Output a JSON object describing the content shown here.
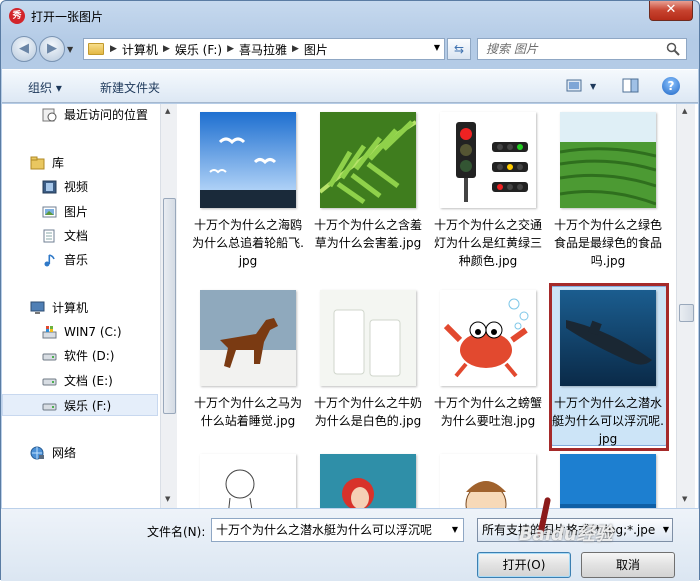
{
  "window": {
    "title": "打开一张图片",
    "app_icon_text": "秀",
    "close_glyph": "✕"
  },
  "nav": {
    "back_glyph": "◀",
    "forward_glyph": "▶",
    "breadcrumbs": [
      "计算机",
      "娱乐 (F:)",
      "喜马拉雅",
      "图片"
    ],
    "search_placeholder": "搜索 图片"
  },
  "toolbar": {
    "organize": "组织 ▾",
    "new_folder": "新建文件夹",
    "help_glyph": "?"
  },
  "sidebar": {
    "items": [
      {
        "label": "最近访问的位置",
        "icon": "recent-places-icon"
      },
      {
        "label": "库",
        "icon": "library-icon"
      },
      {
        "label": "视频",
        "icon": "video-icon"
      },
      {
        "label": "图片",
        "icon": "pictures-icon"
      },
      {
        "label": "文档",
        "icon": "documents-icon"
      },
      {
        "label": "音乐",
        "icon": "music-icon"
      },
      {
        "label": "计算机",
        "icon": "computer-icon"
      },
      {
        "label": "WIN7 (C:)",
        "icon": "windows-drive-icon"
      },
      {
        "label": "软件 (D:)",
        "icon": "drive-icon"
      },
      {
        "label": "文档 (E:)",
        "icon": "drive-icon"
      },
      {
        "label": "娱乐 (F:)",
        "icon": "drive-icon"
      },
      {
        "label": "网络",
        "icon": "network-icon"
      }
    ]
  },
  "files": [
    {
      "name": "十万个为什么之海鸥为什么总追着轮船飞.jpg",
      "thumb": "seagulls"
    },
    {
      "name": "十万个为什么之含羞草为什么会害羞.jpg",
      "thumb": "fern"
    },
    {
      "name": "十万个为什么之交通灯为什么是红黄绿三种颜色.jpg",
      "thumb": "traffic-light"
    },
    {
      "name": "十万个为什么之绿色食品是最绿色的食品吗.jpg",
      "thumb": "tea-field"
    },
    {
      "name": "十万个为什么之马为什么站着睡觉.jpg",
      "thumb": "horse"
    },
    {
      "name": "十万个为什么之牛奶为什么是白色的.jpg",
      "thumb": "milk"
    },
    {
      "name": "十万个为什么之螃蟹为什么要吐泡.jpg",
      "thumb": "crab"
    },
    {
      "name": "十万个为什么之潜水艇为什么可以浮沉呢.jpg",
      "thumb": "submarine"
    }
  ],
  "footer": {
    "filename_label": "文件名(N):",
    "filename_value": "十万个为什么之潜水艇为什么可以浮沉呢",
    "type_value": "所有支持的图片格式(*.jpg;*.jpe",
    "open_button": "打开(O)",
    "cancel_button": "取消"
  },
  "watermark": "Baidu经验",
  "colors": {
    "selection": "#cce4f7",
    "highlight_border": "#a52a2a",
    "close": "#c7432f"
  }
}
